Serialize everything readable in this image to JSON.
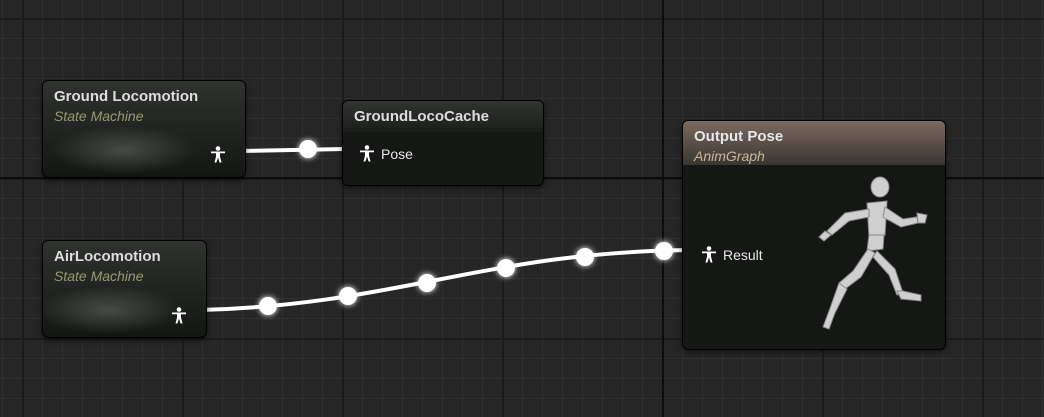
{
  "graph": {
    "nodes": {
      "ground_locomotion": {
        "title": "Ground Locomotion",
        "subtitle": "State Machine"
      },
      "ground_loco_cache": {
        "title": "GroundLocoCache",
        "input_pin": "Pose"
      },
      "air_locomotion": {
        "title": "AirLocomotion",
        "subtitle": "State Machine"
      },
      "output_pose": {
        "title": "Output Pose",
        "subtitle": "AnimGraph",
        "input_pin": "Result"
      }
    },
    "icons": {
      "pose_pin": "pose-pin-icon",
      "preview": "running-mannequin-icon"
    },
    "colors": {
      "background": "#262626",
      "wire": "#ffffff",
      "output_header": "#7a6a5f",
      "subtitle": "#9a9a70"
    }
  }
}
